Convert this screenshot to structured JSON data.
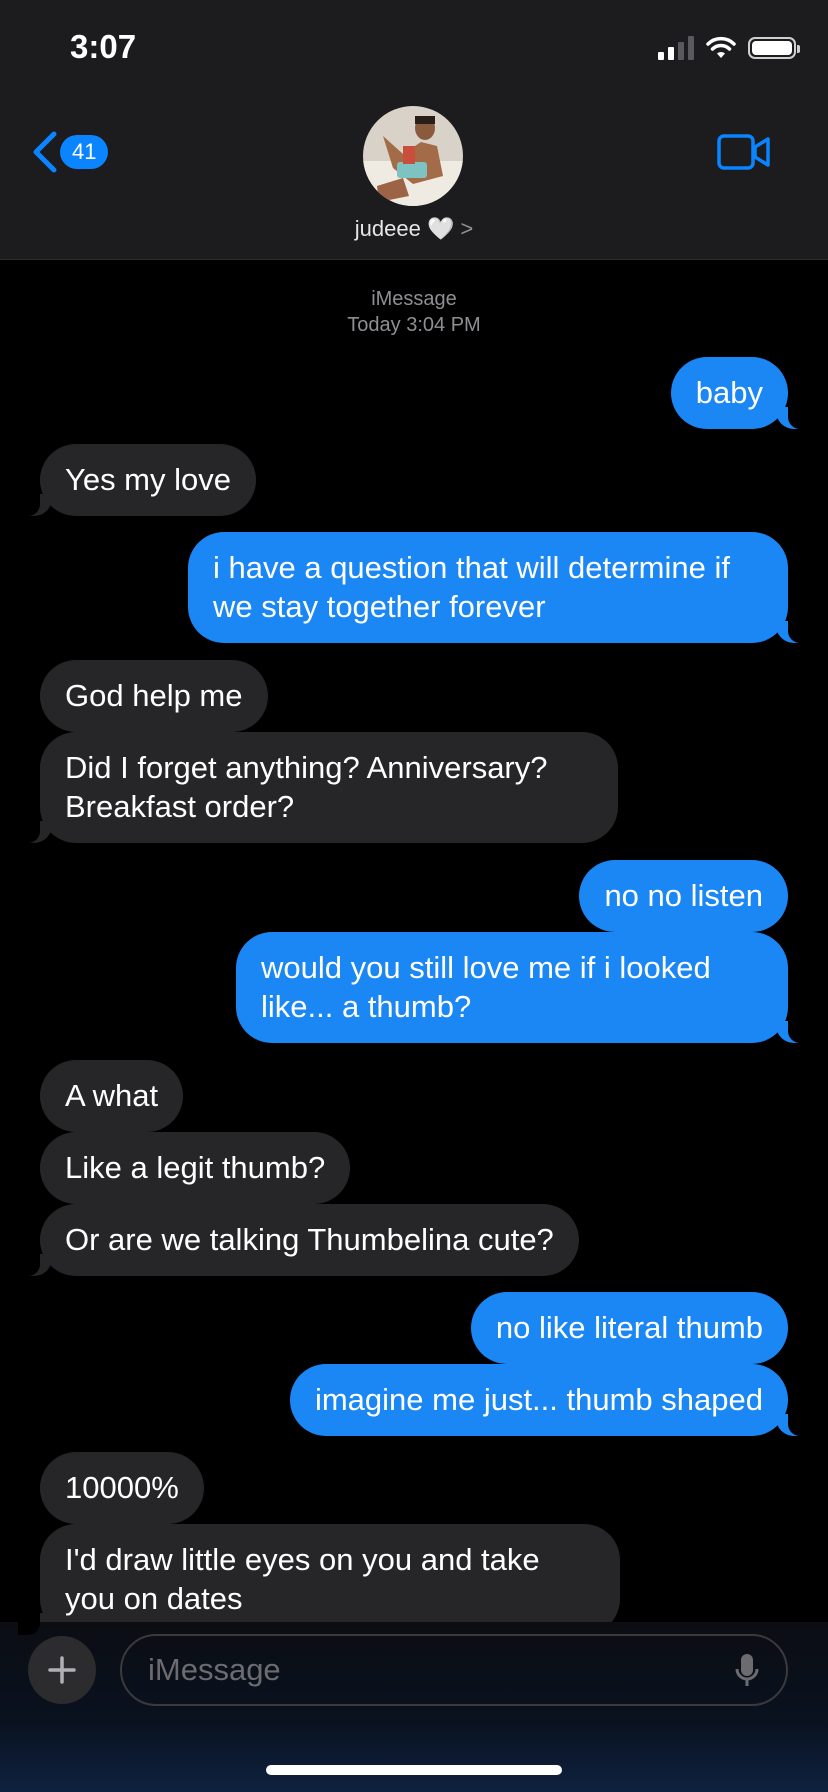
{
  "status_bar": {
    "time": "3:07"
  },
  "header": {
    "back_count": "41",
    "contact_name": "judeee 🤍",
    "chevron": ">"
  },
  "thread": {
    "service": "iMessage",
    "timestamp": "Today 3:04 PM",
    "messages": [
      {
        "from": "me",
        "text": "baby"
      },
      {
        "from": "them",
        "text": "Yes my love"
      },
      {
        "from": "me",
        "text": "i have a question that will determine if we stay together forever"
      },
      {
        "from": "them",
        "text": "God help me"
      },
      {
        "from": "them",
        "text": "Did I forget anything? Anniversary? Breakfast order?"
      },
      {
        "from": "me",
        "text": "no no listen"
      },
      {
        "from": "me",
        "text": "would you still love me if i looked like... a thumb?"
      },
      {
        "from": "them",
        "text": "A what"
      },
      {
        "from": "them",
        "text": "Like a legit thumb?"
      },
      {
        "from": "them",
        "text": "Or are we talking Thumbelina cute?"
      },
      {
        "from": "me",
        "text": "no like literal thumb"
      },
      {
        "from": "me",
        "text": "imagine me just... thumb shaped"
      },
      {
        "from": "them",
        "text": "10000%"
      },
      {
        "from": "them",
        "text": "I'd draw little eyes on you and take you on dates"
      }
    ]
  },
  "compose": {
    "placeholder": "iMessage"
  },
  "colors": {
    "outgoing": "#1a87f5",
    "incoming": "#262628",
    "accent": "#0a84ff"
  }
}
